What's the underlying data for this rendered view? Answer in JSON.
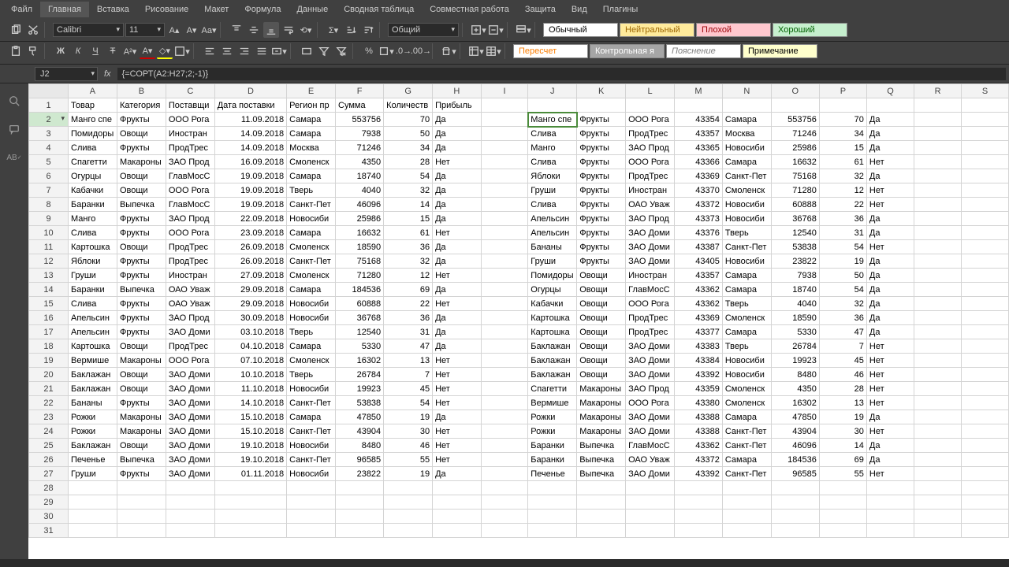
{
  "menu": [
    "Файл",
    "Главная",
    "Вставка",
    "Рисование",
    "Макет",
    "Формула",
    "Данные",
    "Сводная таблица",
    "Совместная работа",
    "Защита",
    "Вид",
    "Плагины"
  ],
  "menu_active": 1,
  "font": {
    "name": "Calibri",
    "size": "11"
  },
  "number_format": "Общий",
  "name_box": "J2",
  "formula": "{=СОРТ(A2:H27;2;-1)}",
  "styles": {
    "normal": "Обычный",
    "neutral": "Нейтральный",
    "bad": "Плохой",
    "good": "Хороший",
    "calc": "Пересчет",
    "check": "Контрольная я",
    "explain": "Пояснение",
    "note": "Примечание"
  },
  "cols": [
    "A",
    "B",
    "C",
    "D",
    "E",
    "F",
    "G",
    "H",
    "I",
    "J",
    "K",
    "L",
    "M",
    "N",
    "O",
    "P",
    "Q",
    "R",
    "S"
  ],
  "headers": [
    "Товар",
    "Категория",
    "Поставщи",
    "Дата поставки",
    "Регион пр",
    "Сумма",
    "Количеств",
    "Прибыль"
  ],
  "rows": [
    [
      "Манго спе",
      "Фрукты",
      "ООО Рога",
      "11.09.2018",
      "Самара",
      "553756",
      "70",
      "Да",
      "",
      "Манго спе",
      "Фрукты",
      "ООО Рога",
      "43354",
      "Самара",
      "553756",
      "70",
      "Да"
    ],
    [
      "Помидоры",
      "Овощи",
      "Иностран",
      "14.09.2018",
      "Самара",
      "7938",
      "50",
      "Да",
      "",
      "Слива",
      "Фрукты",
      "ПродТрес",
      "43357",
      "Москва",
      "71246",
      "34",
      "Да"
    ],
    [
      "Слива",
      "Фрукты",
      "ПродТрес",
      "14.09.2018",
      "Москва",
      "71246",
      "34",
      "Да",
      "",
      "Манго",
      "Фрукты",
      "ЗАО Прод",
      "43365",
      "Новосиби",
      "25986",
      "15",
      "Да"
    ],
    [
      "Спагетти",
      "Макароны",
      "ЗАО Прод",
      "16.09.2018",
      "Смоленск",
      "4350",
      "28",
      "Нет",
      "",
      "Слива",
      "Фрукты",
      "ООО Рога",
      "43366",
      "Самара",
      "16632",
      "61",
      "Нет"
    ],
    [
      "Огурцы",
      "Овощи",
      "ГлавМосС",
      "19.09.2018",
      "Самара",
      "18740",
      "54",
      "Да",
      "",
      "Яблоки",
      "Фрукты",
      "ПродТрес",
      "43369",
      "Санкт-Пет",
      "75168",
      "32",
      "Да"
    ],
    [
      "Кабачки",
      "Овощи",
      "ООО Рога",
      "19.09.2018",
      "Тверь",
      "4040",
      "32",
      "Да",
      "",
      "Груши",
      "Фрукты",
      "Иностран",
      "43370",
      "Смоленск",
      "71280",
      "12",
      "Нет"
    ],
    [
      "Баранки",
      "Выпечка",
      "ГлавМосС",
      "19.09.2018",
      "Санкт-Пет",
      "46096",
      "14",
      "Да",
      "",
      "Слива",
      "Фрукты",
      "ОАО Уваж",
      "43372",
      "Новосиби",
      "60888",
      "22",
      "Нет"
    ],
    [
      "Манго",
      "Фрукты",
      "ЗАО Прод",
      "22.09.2018",
      "Новосиби",
      "25986",
      "15",
      "Да",
      "",
      "Апельсин",
      "Фрукты",
      "ЗАО Прод",
      "43373",
      "Новосиби",
      "36768",
      "36",
      "Да"
    ],
    [
      "Слива",
      "Фрукты",
      "ООО Рога",
      "23.09.2018",
      "Самара",
      "16632",
      "61",
      "Нет",
      "",
      "Апельсин",
      "Фрукты",
      "ЗАО Доми",
      "43376",
      "Тверь",
      "12540",
      "31",
      "Да"
    ],
    [
      "Картошка",
      "Овощи",
      "ПродТрес",
      "26.09.2018",
      "Смоленск",
      "18590",
      "36",
      "Да",
      "",
      "Бананы",
      "Фрукты",
      "ЗАО Доми",
      "43387",
      "Санкт-Пет",
      "53838",
      "54",
      "Нет"
    ],
    [
      "Яблоки",
      "Фрукты",
      "ПродТрес",
      "26.09.2018",
      "Санкт-Пет",
      "75168",
      "32",
      "Да",
      "",
      "Груши",
      "Фрукты",
      "ЗАО Доми",
      "43405",
      "Новосиби",
      "23822",
      "19",
      "Да"
    ],
    [
      "Груши",
      "Фрукты",
      "Иностран",
      "27.09.2018",
      "Смоленск",
      "71280",
      "12",
      "Нет",
      "",
      "Помидоры",
      "Овощи",
      "Иностран",
      "43357",
      "Самара",
      "7938",
      "50",
      "Да"
    ],
    [
      "Баранки",
      "Выпечка",
      "ОАО Уваж",
      "29.09.2018",
      "Самара",
      "184536",
      "69",
      "Да",
      "",
      "Огурцы",
      "Овощи",
      "ГлавМосС",
      "43362",
      "Самара",
      "18740",
      "54",
      "Да"
    ],
    [
      "Слива",
      "Фрукты",
      "ОАО Уваж",
      "29.09.2018",
      "Новосиби",
      "60888",
      "22",
      "Нет",
      "",
      "Кабачки",
      "Овощи",
      "ООО Рога",
      "43362",
      "Тверь",
      "4040",
      "32",
      "Да"
    ],
    [
      "Апельсин",
      "Фрукты",
      "ЗАО Прод",
      "30.09.2018",
      "Новосиби",
      "36768",
      "36",
      "Да",
      "",
      "Картошка",
      "Овощи",
      "ПродТрес",
      "43369",
      "Смоленск",
      "18590",
      "36",
      "Да"
    ],
    [
      "Апельсин",
      "Фрукты",
      "ЗАО Доми",
      "03.10.2018",
      "Тверь",
      "12540",
      "31",
      "Да",
      "",
      "Картошка",
      "Овощи",
      "ПродТрес",
      "43377",
      "Самара",
      "5330",
      "47",
      "Да"
    ],
    [
      "Картошка",
      "Овощи",
      "ПродТрес",
      "04.10.2018",
      "Самара",
      "5330",
      "47",
      "Да",
      "",
      "Баклажан",
      "Овощи",
      "ЗАО Доми",
      "43383",
      "Тверь",
      "26784",
      "7",
      "Нет"
    ],
    [
      "Вермише",
      "Макароны",
      "ООО Рога",
      "07.10.2018",
      "Смоленск",
      "16302",
      "13",
      "Нет",
      "",
      "Баклажан",
      "Овощи",
      "ЗАО Доми",
      "43384",
      "Новосиби",
      "19923",
      "45",
      "Нет"
    ],
    [
      "Баклажан",
      "Овощи",
      "ЗАО Доми",
      "10.10.2018",
      "Тверь",
      "26784",
      "7",
      "Нет",
      "",
      "Баклажан",
      "Овощи",
      "ЗАО Доми",
      "43392",
      "Новосиби",
      "8480",
      "46",
      "Нет"
    ],
    [
      "Баклажан",
      "Овощи",
      "ЗАО Доми",
      "11.10.2018",
      "Новосиби",
      "19923",
      "45",
      "Нет",
      "",
      "Спагетти",
      "Макароны",
      "ЗАО Прод",
      "43359",
      "Смоленск",
      "4350",
      "28",
      "Нет"
    ],
    [
      "Бананы",
      "Фрукты",
      "ЗАО Доми",
      "14.10.2018",
      "Санкт-Пет",
      "53838",
      "54",
      "Нет",
      "",
      "Вермише",
      "Макароны",
      "ООО Рога",
      "43380",
      "Смоленск",
      "16302",
      "13",
      "Нет"
    ],
    [
      "Рожки",
      "Макароны",
      "ЗАО Доми",
      "15.10.2018",
      "Самара",
      "47850",
      "19",
      "Да",
      "",
      "Рожки",
      "Макароны",
      "ЗАО Доми",
      "43388",
      "Самара",
      "47850",
      "19",
      "Да"
    ],
    [
      "Рожки",
      "Макароны",
      "ЗАО Доми",
      "15.10.2018",
      "Санкт-Пет",
      "43904",
      "30",
      "Нет",
      "",
      "Рожки",
      "Макароны",
      "ЗАО Доми",
      "43388",
      "Санкт-Пет",
      "43904",
      "30",
      "Нет"
    ],
    [
      "Баклажан",
      "Овощи",
      "ЗАО Доми",
      "19.10.2018",
      "Новосиби",
      "8480",
      "46",
      "Нет",
      "",
      "Баранки",
      "Выпечка",
      "ГлавМосС",
      "43362",
      "Санкт-Пет",
      "46096",
      "14",
      "Да"
    ],
    [
      "Печенье",
      "Выпечка",
      "ЗАО Доми",
      "19.10.2018",
      "Санкт-Пет",
      "96585",
      "55",
      "Нет",
      "",
      "Баранки",
      "Выпечка",
      "ОАО Уваж",
      "43372",
      "Самара",
      "184536",
      "69",
      "Да"
    ],
    [
      "Груши",
      "Фрукты",
      "ЗАО Доми",
      "01.11.2018",
      "Новосиби",
      "23822",
      "19",
      "Да",
      "",
      "Печенье",
      "Выпечка",
      "ЗАО Доми",
      "43392",
      "Санкт-Пет",
      "96585",
      "55",
      "Нет"
    ]
  ],
  "numeric_cols": [
    5,
    6,
    12,
    14,
    15
  ],
  "right_align_cols": [
    3
  ],
  "selected_cell": {
    "row": 0,
    "col": 9
  },
  "empty_rows": [
    28,
    29,
    30,
    31
  ]
}
